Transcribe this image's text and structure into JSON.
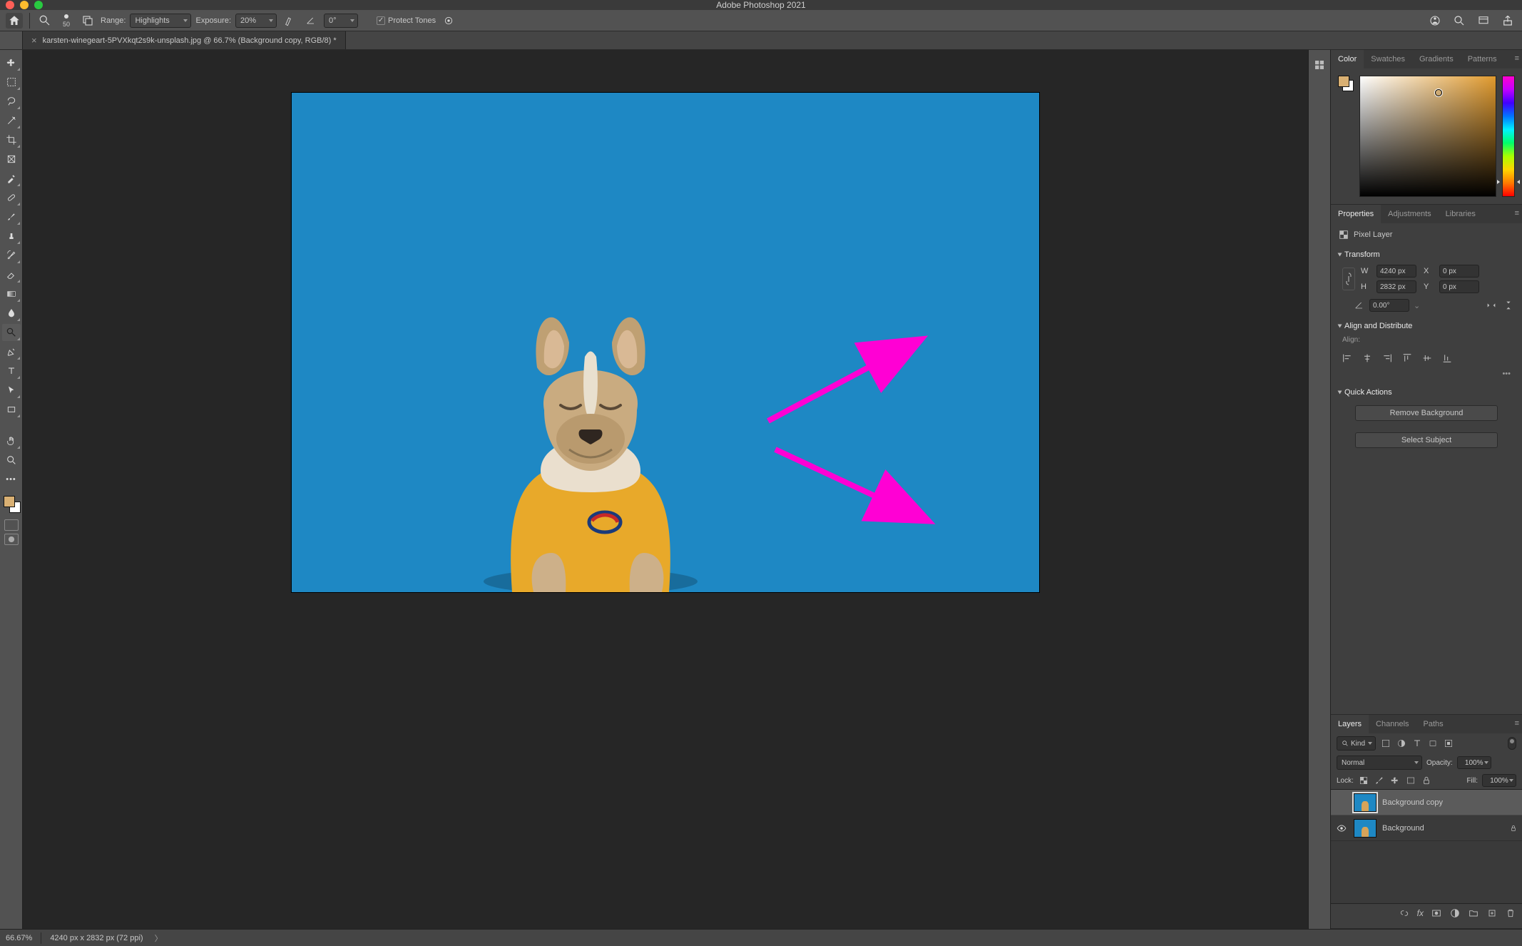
{
  "app": {
    "title": "Adobe Photoshop 2021"
  },
  "document": {
    "tab_label_prefix": "×   ",
    "tab_label": "karsten-winegeart-5PVXkqt2s9k-unsplash.jpg @ 66.7% (Background copy, RGB/8) *"
  },
  "options_bar": {
    "brush_size": "50",
    "range_label": "Range:",
    "range_value": "Highlights",
    "exposure_label": "Exposure:",
    "exposure_value": "20%",
    "angle_value": "0°",
    "protect_tones_label": "Protect Tones"
  },
  "right_icons": {
    "cloud": "cloud-docs",
    "search": "search",
    "workspace": "workspace-switcher",
    "share": "share"
  },
  "panels": {
    "color": {
      "tabs": [
        "Color",
        "Swatches",
        "Gradients",
        "Patterns"
      ],
      "active_tab": 0,
      "fg_color": "#d9b073",
      "bg_color": "#ffffff",
      "hue_base": "#e09a2e"
    },
    "properties": {
      "tabs": [
        "Properties",
        "Adjustments",
        "Libraries"
      ],
      "active_tab": 0,
      "layer_kind_label": "Pixel Layer",
      "transform_label": "Transform",
      "W_label": "W",
      "W_value": "4240 px",
      "H_label": "H",
      "H_value": "2832 px",
      "X_label": "X",
      "X_value": "0 px",
      "Y_label": "Y",
      "Y_value": "0 px",
      "angle_value": "0.00°",
      "align_label": "Align and Distribute",
      "align_sublabel": "Align:",
      "quick_actions_label": "Quick Actions",
      "remove_bg_label": "Remove Background",
      "select_subject_label": "Select Subject"
    },
    "layers": {
      "tabs": [
        "Layers",
        "Channels",
        "Paths"
      ],
      "active_tab": 0,
      "kind_search_placeholder": "Kind",
      "blend_mode": "Normal",
      "opacity_label": "Opacity:",
      "opacity_value": "100%",
      "lock_label": "Lock:",
      "fill_label": "Fill:",
      "fill_value": "100%",
      "items": [
        {
          "name": "Background copy",
          "visible": false,
          "selected": true,
          "locked": false
        },
        {
          "name": "Background",
          "visible": true,
          "selected": false,
          "locked": true
        }
      ]
    }
  },
  "status_bar": {
    "zoom": "66.67%",
    "doc_info": "4240 px x 2832 px (72 ppi)"
  },
  "toolbar_tools": [
    "move",
    "artboard",
    "lasso",
    "quick-select",
    "crop",
    "frame",
    "eyedropper",
    "spot-heal",
    "brush",
    "clone-stamp",
    "history-brush",
    "eraser",
    "gradient",
    "blur",
    "dodge",
    "pen",
    "type",
    "path-select",
    "rectangle",
    "hand",
    "zoom"
  ],
  "layers_bottom_icons": [
    "link",
    "fx",
    "mask",
    "adjustment",
    "group",
    "new",
    "trash"
  ]
}
